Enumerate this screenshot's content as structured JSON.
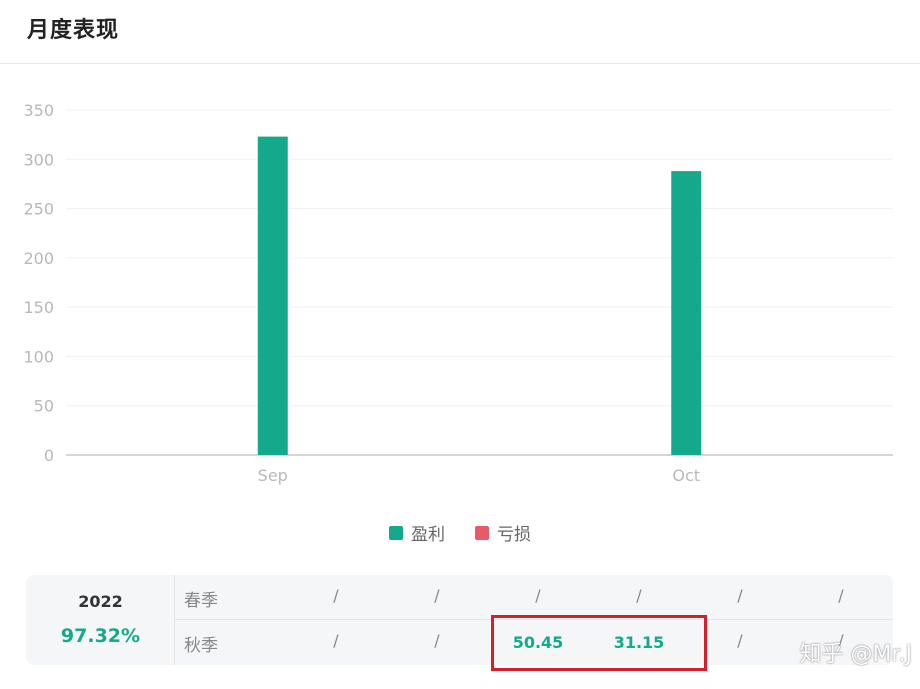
{
  "header": {
    "title": "月度表现"
  },
  "chart_data": {
    "type": "bar",
    "categories": [
      "Sep",
      "Oct"
    ],
    "series": [
      {
        "name": "盈利",
        "color": "#13a98a",
        "values": [
          323,
          288
        ]
      },
      {
        "name": "亏损",
        "color": "#e85a6a",
        "values": [
          0,
          0
        ]
      }
    ],
    "yticks": [
      "0",
      "50",
      "100",
      "150",
      "200",
      "250",
      "300",
      "350"
    ],
    "ylim": [
      0,
      350
    ],
    "grid": true,
    "legend": "bottom-center"
  },
  "legend": {
    "items": [
      {
        "label": "盈利",
        "color": "#13a98a"
      },
      {
        "label": "亏损",
        "color": "#e85a6a"
      }
    ]
  },
  "table": {
    "year": "2022",
    "year_pct": "97.32%",
    "rows": [
      {
        "label": "春季",
        "cells": [
          "/",
          "/",
          "/",
          "/",
          "/",
          "/"
        ]
      },
      {
        "label": "秋季",
        "cells": [
          "/",
          "/",
          "50.45",
          "31.15",
          "/",
          "/"
        ]
      }
    ]
  },
  "watermark": "知乎 @Mr.J"
}
